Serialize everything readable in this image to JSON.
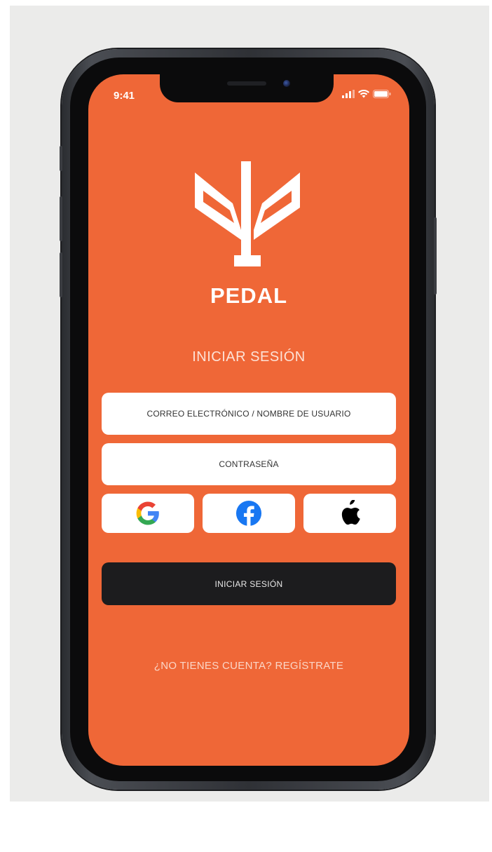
{
  "status_bar": {
    "time": "9:41",
    "icons": [
      "signal-icon",
      "wifi-icon",
      "battery-icon"
    ]
  },
  "brand": {
    "name": "PEDAL",
    "logo_icon": "pedal-logo-icon"
  },
  "login": {
    "heading": "INICIAR SESIÓN",
    "email_placeholder": "CORREO ELECTRÓNICO / NOMBRE DE USUARIO",
    "password_placeholder": "CONTRASEÑA",
    "social": [
      {
        "name": "google",
        "icon": "google-icon"
      },
      {
        "name": "facebook",
        "icon": "facebook-icon"
      },
      {
        "name": "apple",
        "icon": "apple-icon"
      }
    ],
    "submit_label": "INICIAR SESIÓN",
    "signup_link": "¿NO TIENES CUENTA? REGÍSTRATE"
  },
  "colors": {
    "background": "#ef6737",
    "button_dark": "#1c1c1e",
    "field": "#ffffff",
    "google_blue": "#4285f4",
    "google_red": "#ea4335",
    "google_yellow": "#fbbc05",
    "google_green": "#34a853",
    "facebook_blue": "#1877f2"
  }
}
